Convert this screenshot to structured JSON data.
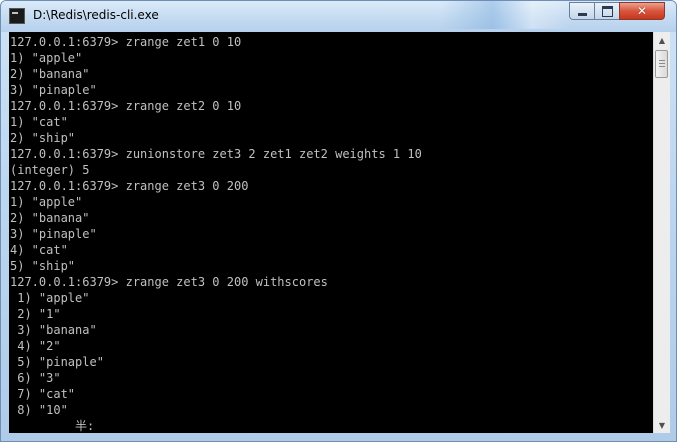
{
  "window": {
    "title": "D:\\Redis\\redis-cli.exe",
    "icon": "console-icon"
  },
  "caption_buttons": {
    "minimize": "minimize-icon",
    "maximize": "maximize-icon",
    "close": "close-icon",
    "close_glyph": "✕"
  },
  "console": {
    "lines": [
      "127.0.0.1:6379> zrange zet1 0 10",
      "1) \"apple\"",
      "2) \"banana\"",
      "3) \"pinaple\"",
      "127.0.0.1:6379> zrange zet2 0 10",
      "1) \"cat\"",
      "2) \"ship\"",
      "127.0.0.1:6379> zunionstore zet3 2 zet1 zet2 weights 1 10",
      "(integer) 5",
      "127.0.0.1:6379> zrange zet3 0 200",
      "1) \"apple\"",
      "2) \"banana\"",
      "3) \"pinaple\"",
      "4) \"cat\"",
      "5) \"ship\"",
      "127.0.0.1:6379> zrange zet3 0 200 withscores",
      " 1) \"apple\"",
      " 2) \"1\"",
      " 3) \"banana\"",
      " 4) \"2\"",
      " 5) \"pinaple\"",
      " 6) \"3\"",
      " 7) \"cat\"",
      " 8) \"10\"",
      "         半:"
    ]
  },
  "scrollbar": {
    "up_arrow": "▲",
    "down_arrow": "▼",
    "position": 0.0
  }
}
